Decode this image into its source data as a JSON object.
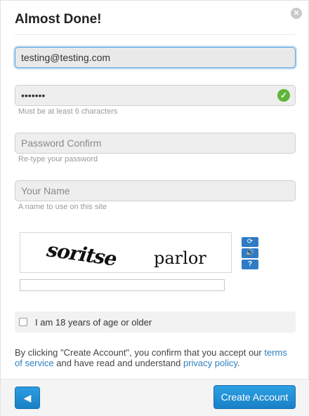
{
  "dialog": {
    "title": "Almost Done!",
    "close_icon": "✕"
  },
  "form": {
    "email": {
      "value": "testing@testing.com",
      "placeholder": ""
    },
    "password": {
      "value": "•••••••",
      "hint": "Must be at least 6 characters",
      "valid_icon": "✓"
    },
    "password_confirm": {
      "placeholder": "Password Confirm",
      "hint": "Re-type your password"
    },
    "name": {
      "placeholder": "Your Name",
      "hint": "A name to use on this site"
    }
  },
  "captcha": {
    "word1": "soritse",
    "word2": "parlor",
    "refresh_icon": "⟳",
    "audio_icon": "🔊",
    "help_icon": "?",
    "input_value": ""
  },
  "age": {
    "label": "I am 18 years of age or older",
    "checked": false
  },
  "terms": {
    "prefix": "By clicking \"Create Account\", you confirm that you accept our ",
    "terms_link": "terms of service",
    "middle": " and have read and understand ",
    "privacy_link": "privacy policy",
    "suffix": "."
  },
  "footer": {
    "back_icon": "◀",
    "create_label": "Create Account"
  },
  "colors": {
    "accent": "#1a80c8",
    "valid": "#5fb53a",
    "link": "#2b7fc2"
  }
}
